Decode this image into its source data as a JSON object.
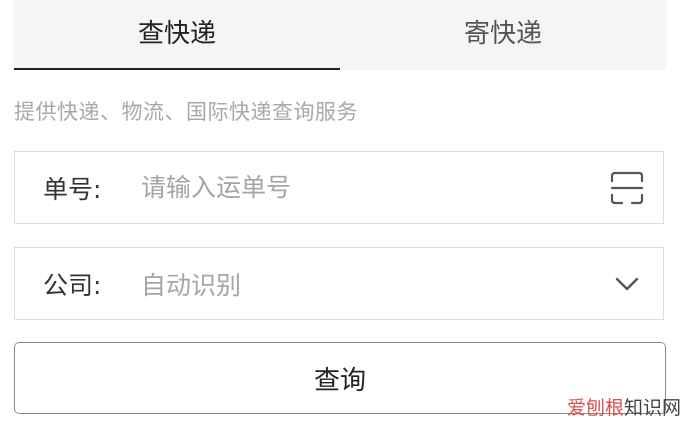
{
  "tabs": [
    {
      "label": "查快递",
      "active": true
    },
    {
      "label": "寄快递",
      "active": false
    }
  ],
  "subtitle": "提供快递、物流、国际快递查询服务",
  "number_field": {
    "label": "单号:",
    "placeholder": "请输入运单号",
    "icon": "scan-icon"
  },
  "company_field": {
    "label": "公司:",
    "value": "自动识别",
    "icon": "chevron-down-icon"
  },
  "query_button": {
    "label": "查询"
  },
  "watermark": {
    "brand": "爱刨根",
    "rest": "知识网"
  },
  "colors": {
    "tab_bg": "#f5f5f5",
    "border": "#dcdcdc",
    "placeholder": "#a5a5a5",
    "active_underline": "#222222",
    "watermark_brand": "#d9534f"
  }
}
